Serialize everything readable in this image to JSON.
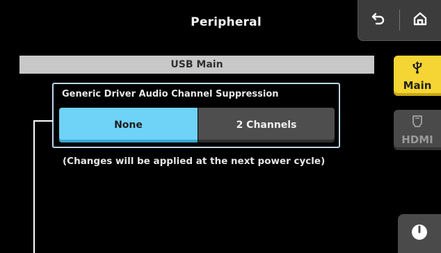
{
  "header": {
    "title": "Peripheral",
    "back_icon": "back-arrow-icon",
    "home_icon": "home-icon"
  },
  "section": {
    "title": "USB Main"
  },
  "setting": {
    "label": "Generic Driver Audio Channel Suppression",
    "options": [
      "None",
      "2 Channels"
    ],
    "selected": "None",
    "note": "(Changes will be applied at the next power cycle)"
  },
  "side_tabs": [
    {
      "label": "Main",
      "icon": "usb-icon",
      "active": true
    },
    {
      "label": "HDMI",
      "icon": "hdmi-icon",
      "active": false
    }
  ],
  "power": {
    "icon": "power-icon"
  },
  "colors": {
    "selected": "#6ED3F7",
    "active_tab": "#F4D533",
    "section_bar": "#C8C8C8",
    "panel_border": "#BCD7EE"
  }
}
